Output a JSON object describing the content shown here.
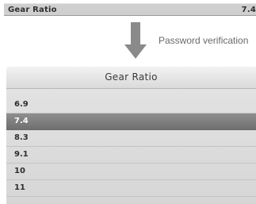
{
  "top_bar": {
    "label": "Gear Ratio",
    "value": "7.4"
  },
  "annotation": {
    "text": "Password verification"
  },
  "dialog": {
    "title": "Gear Ratio",
    "options": [
      "6.9",
      "7.4",
      "8.3",
      "9.1",
      "10",
      "11"
    ],
    "selected_index": 1
  }
}
